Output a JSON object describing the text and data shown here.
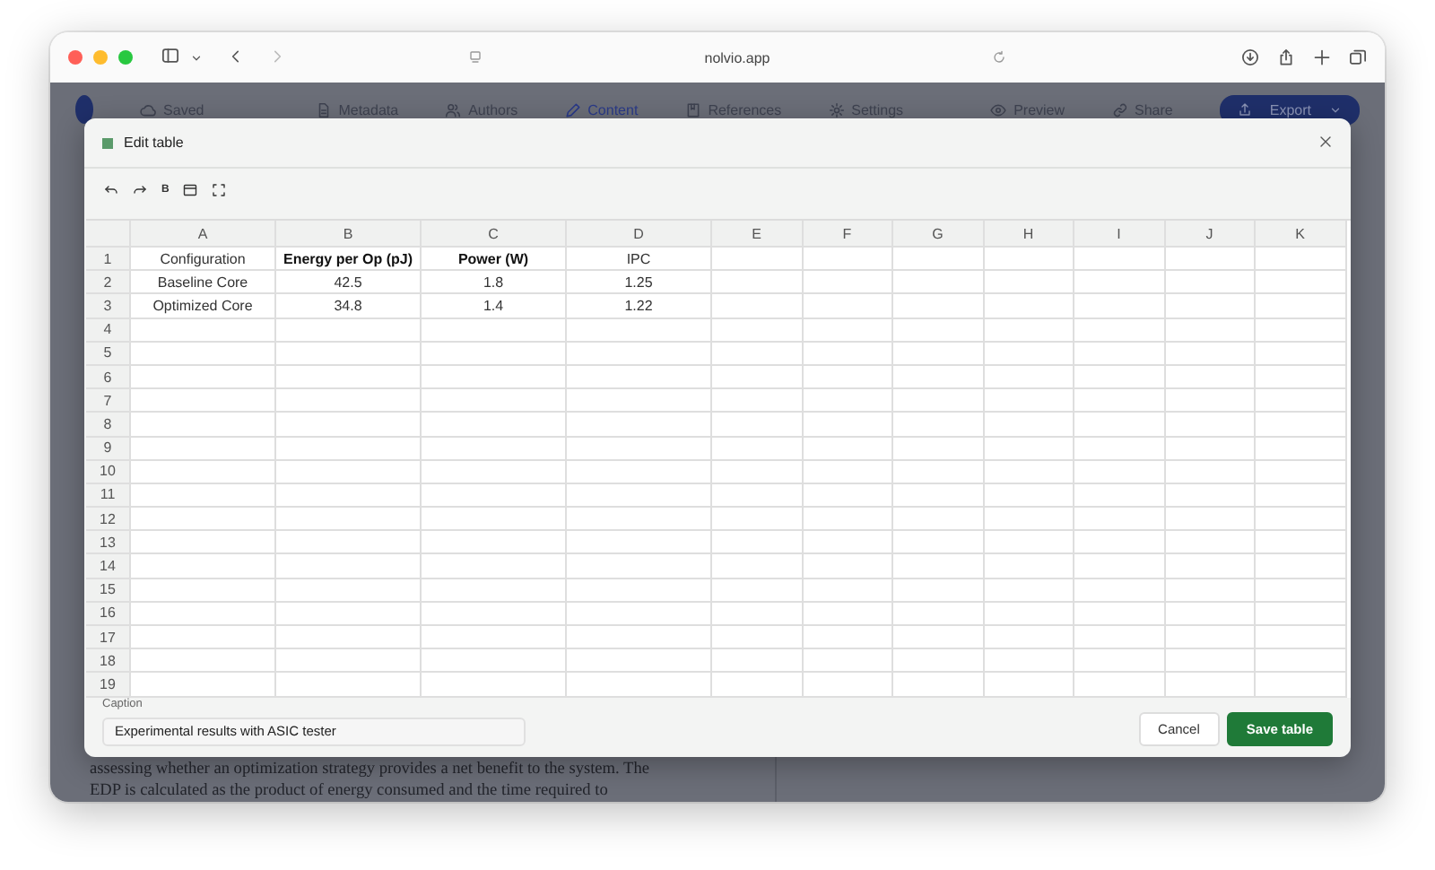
{
  "browser": {
    "url": "nolvio.app"
  },
  "app_toolbar": {
    "status": "Saved",
    "tabs": [
      {
        "label": "Metadata",
        "selected": false
      },
      {
        "label": "Authors",
        "selected": false
      },
      {
        "label": "Content",
        "selected": true
      },
      {
        "label": "References",
        "selected": false
      },
      {
        "label": "Settings",
        "selected": false
      }
    ],
    "actions": [
      "Preview",
      "Share"
    ],
    "export": "Export"
  },
  "background_text": [
    "assessing whether an optimization strategy provides a net benefit to the system. The",
    "EDP is calculated as the product of energy consumed and the time required to"
  ],
  "dialog": {
    "title": "Edit table",
    "toolbar": [
      {
        "kind": "undo"
      },
      {
        "kind": "redo"
      },
      {
        "kind": "text",
        "label": "B"
      },
      {
        "kind": "table"
      },
      {
        "kind": "expand"
      }
    ],
    "columns": [
      "A",
      "B",
      "C",
      "D",
      "E",
      "F",
      "G",
      "H",
      "I",
      "J",
      "K"
    ],
    "row_numbers": [
      "1",
      "2",
      "3",
      "4",
      "5",
      "6",
      "7",
      "8",
      "9",
      "10",
      "11",
      "12",
      "13",
      "14",
      "15",
      "16",
      "17",
      "18",
      "19"
    ],
    "rows": [
      [
        {
          "text": "Configuration",
          "bold": false
        },
        {
          "text": "Energy per Op (pJ)",
          "bold": true
        },
        {
          "text": "Power (W)",
          "bold": true
        },
        {
          "text": "IPC",
          "bold": false
        }
      ],
      [
        {
          "text": "Baseline Core",
          "bold": false
        },
        {
          "text": "42.5",
          "bold": false
        },
        {
          "text": "1.8",
          "bold": false
        },
        {
          "text": "1.25",
          "bold": false
        }
      ],
      [
        {
          "text": "Optimized Core",
          "bold": false
        },
        {
          "text": "34.8",
          "bold": false
        },
        {
          "text": "1.4",
          "bold": false
        },
        {
          "text": "1.22",
          "bold": false
        }
      ]
    ],
    "caption_label": "Caption",
    "caption_value": "Experimental results with ASIC tester",
    "buttons": [
      {
        "label": "Cancel",
        "kind": "secondary"
      },
      {
        "label": "Save table",
        "kind": "primary"
      }
    ]
  }
}
